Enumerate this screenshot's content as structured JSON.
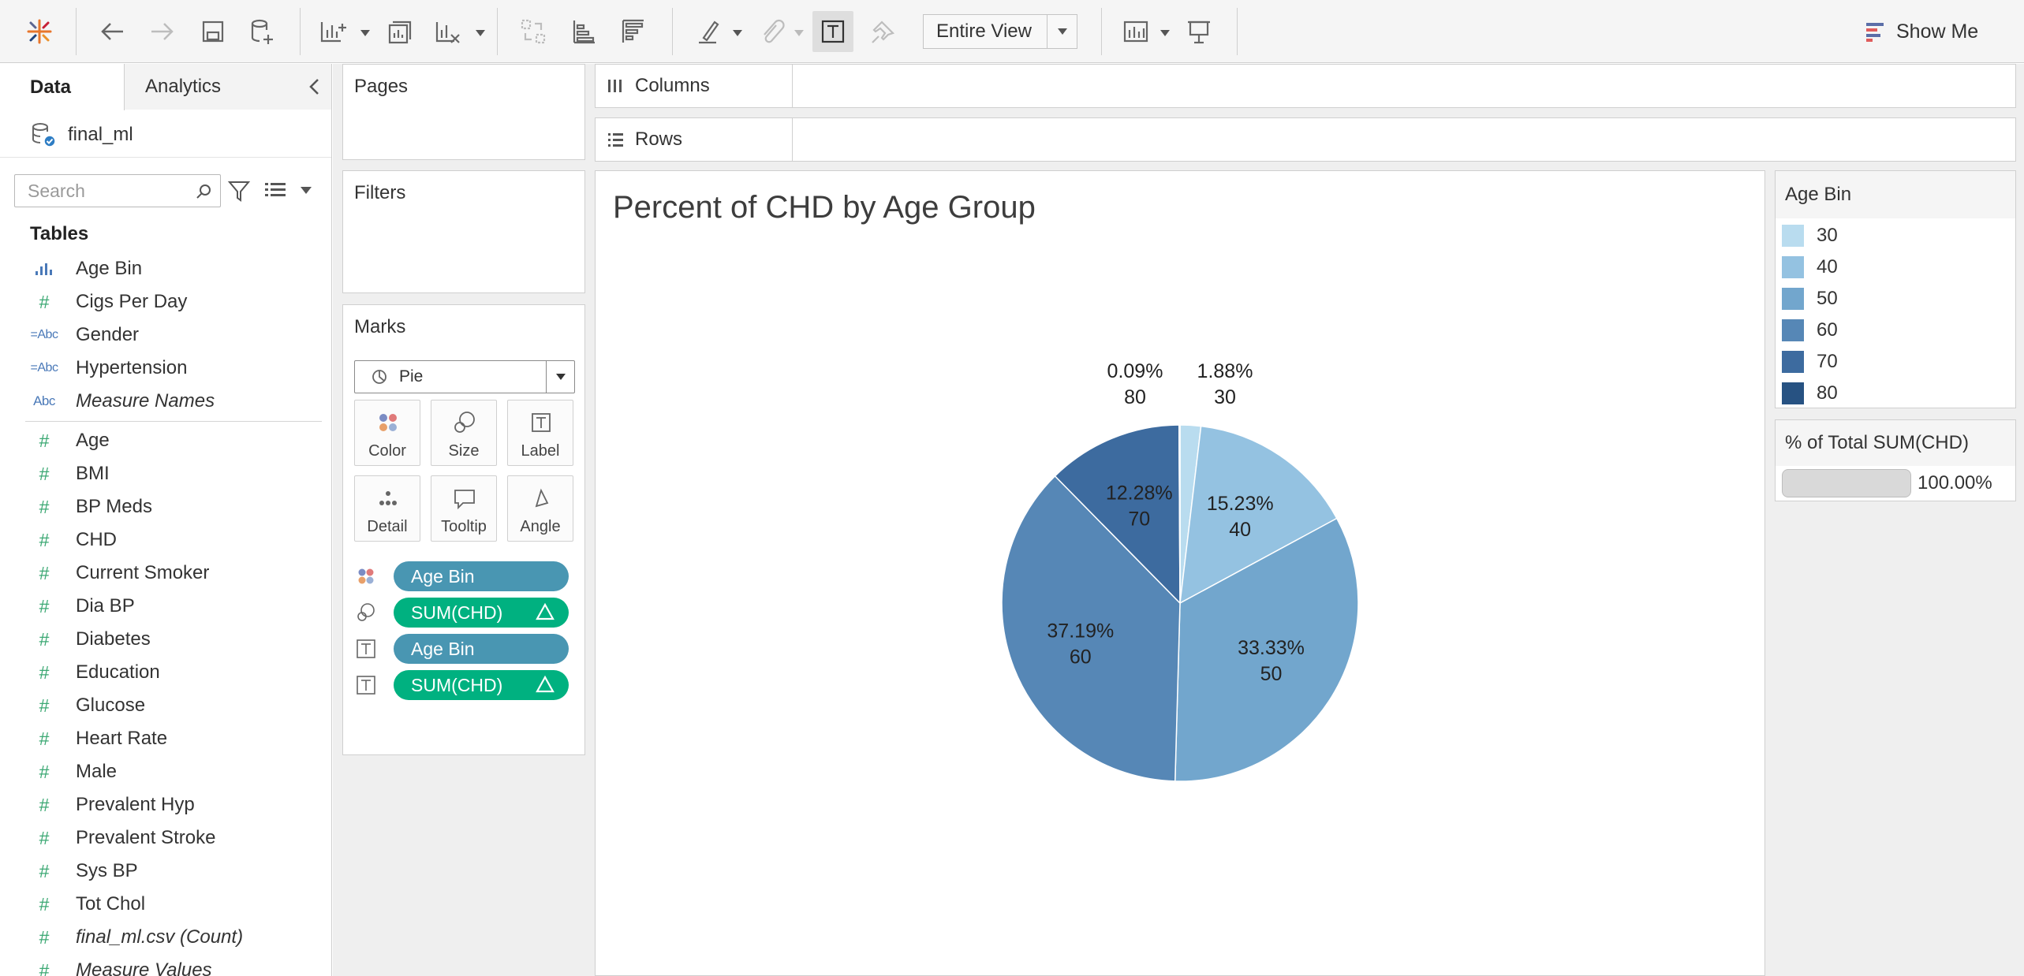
{
  "toolbar": {
    "fit_dropdown": "Entire View",
    "show_me_label": "Show Me"
  },
  "data_pane": {
    "tab_data": "Data",
    "tab_analytics": "Analytics",
    "datasource": "final_ml",
    "search_placeholder": "Search",
    "tables_heading": "Tables",
    "dimensions": [
      {
        "name": "Age Bin",
        "type": "bin",
        "italic": false
      },
      {
        "name": "Cigs Per Day",
        "type": "number",
        "italic": false
      },
      {
        "name": "Gender",
        "type": "string-calc",
        "italic": false
      },
      {
        "name": "Hypertension",
        "type": "string-calc",
        "italic": false
      },
      {
        "name": "Measure Names",
        "type": "string",
        "italic": true
      }
    ],
    "measures": [
      {
        "name": "Age",
        "type": "number",
        "italic": false
      },
      {
        "name": "BMI",
        "type": "number",
        "italic": false
      },
      {
        "name": "BP Meds",
        "type": "number",
        "italic": false
      },
      {
        "name": "CHD",
        "type": "number",
        "italic": false
      },
      {
        "name": "Current Smoker",
        "type": "number",
        "italic": false
      },
      {
        "name": "Dia BP",
        "type": "number",
        "italic": false
      },
      {
        "name": "Diabetes",
        "type": "number",
        "italic": false
      },
      {
        "name": "Education",
        "type": "number",
        "italic": false
      },
      {
        "name": "Glucose",
        "type": "number",
        "italic": false
      },
      {
        "name": "Heart Rate",
        "type": "number",
        "italic": false
      },
      {
        "name": "Male",
        "type": "number",
        "italic": false
      },
      {
        "name": "Prevalent Hyp",
        "type": "number",
        "italic": false
      },
      {
        "name": "Prevalent Stroke",
        "type": "number",
        "italic": false
      },
      {
        "name": "Sys BP",
        "type": "number",
        "italic": false
      },
      {
        "name": "Tot Chol",
        "type": "number",
        "italic": false
      },
      {
        "name": "final_ml.csv (Count)",
        "type": "number",
        "italic": true
      },
      {
        "name": "Measure Values",
        "type": "number",
        "italic": true
      }
    ]
  },
  "cards": {
    "pages": "Pages",
    "filters": "Filters",
    "marks": "Marks",
    "mark_type": "Pie",
    "mark_buttons": [
      "Color",
      "Size",
      "Label",
      "Detail",
      "Tooltip",
      "Angle"
    ],
    "pills": [
      {
        "icon": "color",
        "label": "Age Bin",
        "color": "blue",
        "delta": false
      },
      {
        "icon": "size",
        "label": "SUM(CHD)",
        "color": "green",
        "delta": true
      },
      {
        "icon": "label",
        "label": "Age Bin",
        "color": "blue",
        "delta": false
      },
      {
        "icon": "label",
        "label": "SUM(CHD)",
        "color": "green",
        "delta": true
      }
    ]
  },
  "shelves": {
    "columns": "Columns",
    "rows": "Rows"
  },
  "view": {
    "title": "Percent of CHD by Age Group"
  },
  "chart_data": {
    "type": "pie",
    "title": "Percent of CHD by Age Group",
    "slices": [
      {
        "category": "30",
        "pct": 1.88,
        "label_pct": "1.88%",
        "color": "#b9dcef"
      },
      {
        "category": "40",
        "pct": 15.23,
        "label_pct": "15.23%",
        "color": "#94c2e1"
      },
      {
        "category": "50",
        "pct": 33.33,
        "label_pct": "33.33%",
        "color": "#72a6cd"
      },
      {
        "category": "60",
        "pct": 37.19,
        "label_pct": "37.19%",
        "color": "#5687b6"
      },
      {
        "category": "70",
        "pct": 12.28,
        "label_pct": "12.28%",
        "color": "#3d6b9f"
      },
      {
        "category": "80",
        "pct": 0.09,
        "label_pct": "0.09%",
        "color": "#275282"
      }
    ],
    "start_angle": "12 o'clock",
    "direction": "clockwise"
  },
  "legends": {
    "color_title": "Age Bin",
    "color_items": [
      {
        "label": "30",
        "color": "#b9dcef"
      },
      {
        "label": "40",
        "color": "#94c2e1"
      },
      {
        "label": "50",
        "color": "#72a6cd"
      },
      {
        "label": "60",
        "color": "#5687b6"
      },
      {
        "label": "70",
        "color": "#3d6b9f"
      },
      {
        "label": "80",
        "color": "#275282"
      }
    ],
    "size_title": "% of Total SUM(CHD)",
    "size_value": "100.00%"
  }
}
